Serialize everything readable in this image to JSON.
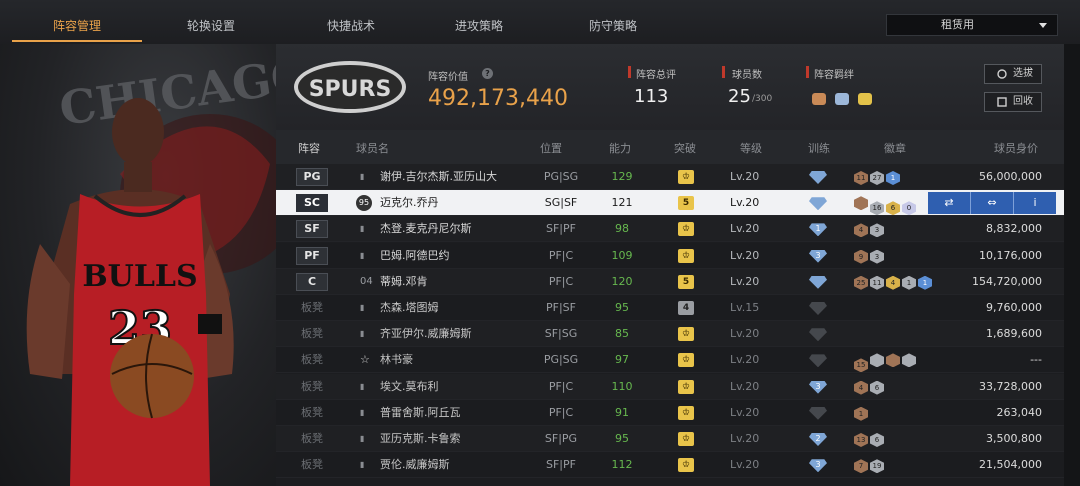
{
  "nav": {
    "tabs": [
      "阵容管理",
      "轮换设置",
      "快捷战术",
      "进攻策略",
      "防守策略"
    ],
    "active_index": 0,
    "dropdown_value": "租赁用"
  },
  "left_art": {
    "wordmark": "CHICAGO BULLS",
    "jersey_text": "BULLS",
    "jersey_number": "23"
  },
  "team": {
    "logo_text": "SPURS",
    "value_label": "阵容价值",
    "value": "492,173,440",
    "overall_label": "阵容总评",
    "overall": "113",
    "count_label": "球员数",
    "count": "25",
    "count_max": "/300",
    "bonds_label": "阵容羁绊",
    "filter_label": "选拔",
    "recycle_label": "回收"
  },
  "table": {
    "headers": [
      "阵容",
      "球员名",
      "位置",
      "能力",
      "突破",
      "等级",
      "训练",
      "徽章",
      "球员身价"
    ],
    "action_icons": [
      "swap-icon",
      "training-icon",
      "info-icon"
    ],
    "rows": [
      {
        "lineup": "PG",
        "name": "谢伊.吉尔杰斯.亚历山大",
        "pos": "PG|SG",
        "ovr": "129",
        "brk": "",
        "lv": "Lv.20",
        "train": true,
        "badges": [
          [
            "11",
            "b-brz"
          ],
          [
            "27",
            "b-sil"
          ],
          [
            "1",
            "b-blue"
          ]
        ],
        "price": "56,000,000"
      },
      {
        "lineup": "SC",
        "icon": "95",
        "name": "迈克尔.乔丹",
        "pos": "SG|SF",
        "ovr": "121",
        "brk": "5",
        "lv": "Lv.20",
        "train": true,
        "badges": [
          [
            "",
            "b-brz"
          ],
          [
            "16",
            "b-sil"
          ],
          [
            "6",
            "b-gold"
          ],
          [
            "0",
            "b-pur"
          ]
        ],
        "price": "",
        "selected": true
      },
      {
        "lineup": "SF",
        "name": "杰登.麦克丹尼尔斯",
        "pos": "SF|PF",
        "ovr": "98",
        "brk": "",
        "lv": "Lv.20",
        "train": true,
        "train_num": "1",
        "badges": [
          [
            "4",
            "b-brz"
          ],
          [
            "3",
            "b-sil"
          ]
        ],
        "price": "8,832,000"
      },
      {
        "lineup": "PF",
        "name": "巴姆.阿德巴约",
        "pos": "PF|C",
        "ovr": "109",
        "brk": "",
        "lv": "Lv.20",
        "train": true,
        "train_num": "3",
        "badges": [
          [
            "9",
            "b-brz"
          ],
          [
            "3",
            "b-sil"
          ]
        ],
        "price": "10,176,000"
      },
      {
        "lineup": "C",
        "sig_text": "04",
        "name": "蒂姆.邓肯",
        "pos": "PF|C",
        "ovr": "120",
        "brk": "5",
        "lv": "Lv.20",
        "train": true,
        "badges": [
          [
            "25",
            "b-brz"
          ],
          [
            "11",
            "b-sil"
          ],
          [
            "4",
            "b-gold"
          ],
          [
            "1",
            "b-sil"
          ],
          [
            "1",
            "b-blue"
          ]
        ],
        "price": "154,720,000"
      },
      {
        "lineup": "板凳",
        "name": "杰森.塔图姆",
        "pos": "PF|SF",
        "ovr": "95",
        "brk": "4",
        "brk_gray": true,
        "lv": "Lv.15",
        "train": false,
        "badges": [],
        "price": "9,760,000"
      },
      {
        "lineup": "板凳",
        "name": "齐亚伊尔.威廉姆斯",
        "pos": "SF|SG",
        "ovr": "85",
        "brk": "",
        "lv": "Lv.20",
        "train": false,
        "badges": [],
        "price": "1,689,600"
      },
      {
        "lineup": "板凳",
        "icon_star": true,
        "name": "林书豪",
        "pos": "PG|SG",
        "ovr": "97",
        "brk": "",
        "lv": "Lv.20",
        "train": false,
        "badges": [
          [
            "15",
            "b-brz"
          ],
          [
            "",
            "b-sil"
          ],
          [
            "",
            "b-brz"
          ],
          [
            "",
            "b-sil"
          ]
        ],
        "price": "---"
      },
      {
        "lineup": "板凳",
        "name": "埃文.莫布利",
        "pos": "PF|C",
        "ovr": "110",
        "brk": "",
        "lv": "Lv.20",
        "train": true,
        "train_num": "3",
        "badges": [
          [
            "4",
            "b-brz"
          ],
          [
            "6",
            "b-sil"
          ]
        ],
        "price": "33,728,000"
      },
      {
        "lineup": "板凳",
        "name": "普雷舍斯.阿丘瓦",
        "pos": "PF|C",
        "ovr": "91",
        "brk": "",
        "lv": "Lv.20",
        "train": false,
        "badges": [
          [
            "1",
            "b-brz"
          ]
        ],
        "price": "263,040"
      },
      {
        "lineup": "板凳",
        "name": "亚历克斯.卡鲁索",
        "pos": "SF|PG",
        "ovr": "95",
        "brk": "",
        "lv": "Lv.20",
        "train": true,
        "train_num": "2",
        "badges": [
          [
            "13",
            "b-brz"
          ],
          [
            "6",
            "b-sil"
          ]
        ],
        "price": "3,500,800"
      },
      {
        "lineup": "板凳",
        "name": "贾伦.威廉姆斯",
        "pos": "SF|PF",
        "ovr": "112",
        "brk": "",
        "lv": "Lv.20",
        "train": true,
        "train_num": "3",
        "badges": [
          [
            "7",
            "b-brz"
          ],
          [
            "19",
            "b-sil"
          ]
        ],
        "price": "21,504,000"
      }
    ]
  },
  "colors": {
    "accent": "#e9a24a",
    "green": "#67b84f",
    "selected_action": "#2f5fb0",
    "red_mark": "#c0392b"
  }
}
